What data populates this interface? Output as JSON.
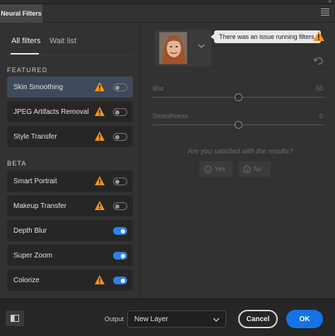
{
  "panel": {
    "tab_label": "Neural Filters"
  },
  "left_tabs": [
    {
      "label": "All filters"
    },
    {
      "label": "Wait list"
    }
  ],
  "sections": {
    "featured": "FEATURED",
    "beta": "BETA"
  },
  "featured_filters": [
    {
      "name": "Skin Smoothing",
      "warning": true,
      "enabled": false,
      "selected": true
    },
    {
      "name": "JPEG Artifacts Removal",
      "warning": true,
      "enabled": false,
      "selected": false
    },
    {
      "name": "Style Transfer",
      "warning": true,
      "enabled": false,
      "selected": false
    }
  ],
  "beta_filters": [
    {
      "name": "Smart Portrait",
      "warning": true,
      "enabled": false
    },
    {
      "name": "Makeup Transfer",
      "warning": true,
      "enabled": false
    },
    {
      "name": "Depth Blur",
      "warning": false,
      "enabled": true
    },
    {
      "name": "Super Zoom",
      "warning": false,
      "enabled": true
    },
    {
      "name": "Colorize",
      "warning": true,
      "enabled": true
    }
  ],
  "right": {
    "tooltip": "There was an issue running filters.",
    "sliders": [
      {
        "label": "Blur",
        "value": "50",
        "level": 0.5
      },
      {
        "label": "Smoothness",
        "value": "0",
        "level": 0.5
      }
    ],
    "question": "Are you satisfied with the results?",
    "yes_label": "Yes",
    "no_label": "No"
  },
  "footer": {
    "output_label": "Output",
    "output_value": "New Layer",
    "cancel_label": "Cancel",
    "ok_label": "OK"
  },
  "colors": {
    "accent": "#1473e6",
    "warning": "#f29423",
    "selected_row": "#3d4a5c"
  }
}
